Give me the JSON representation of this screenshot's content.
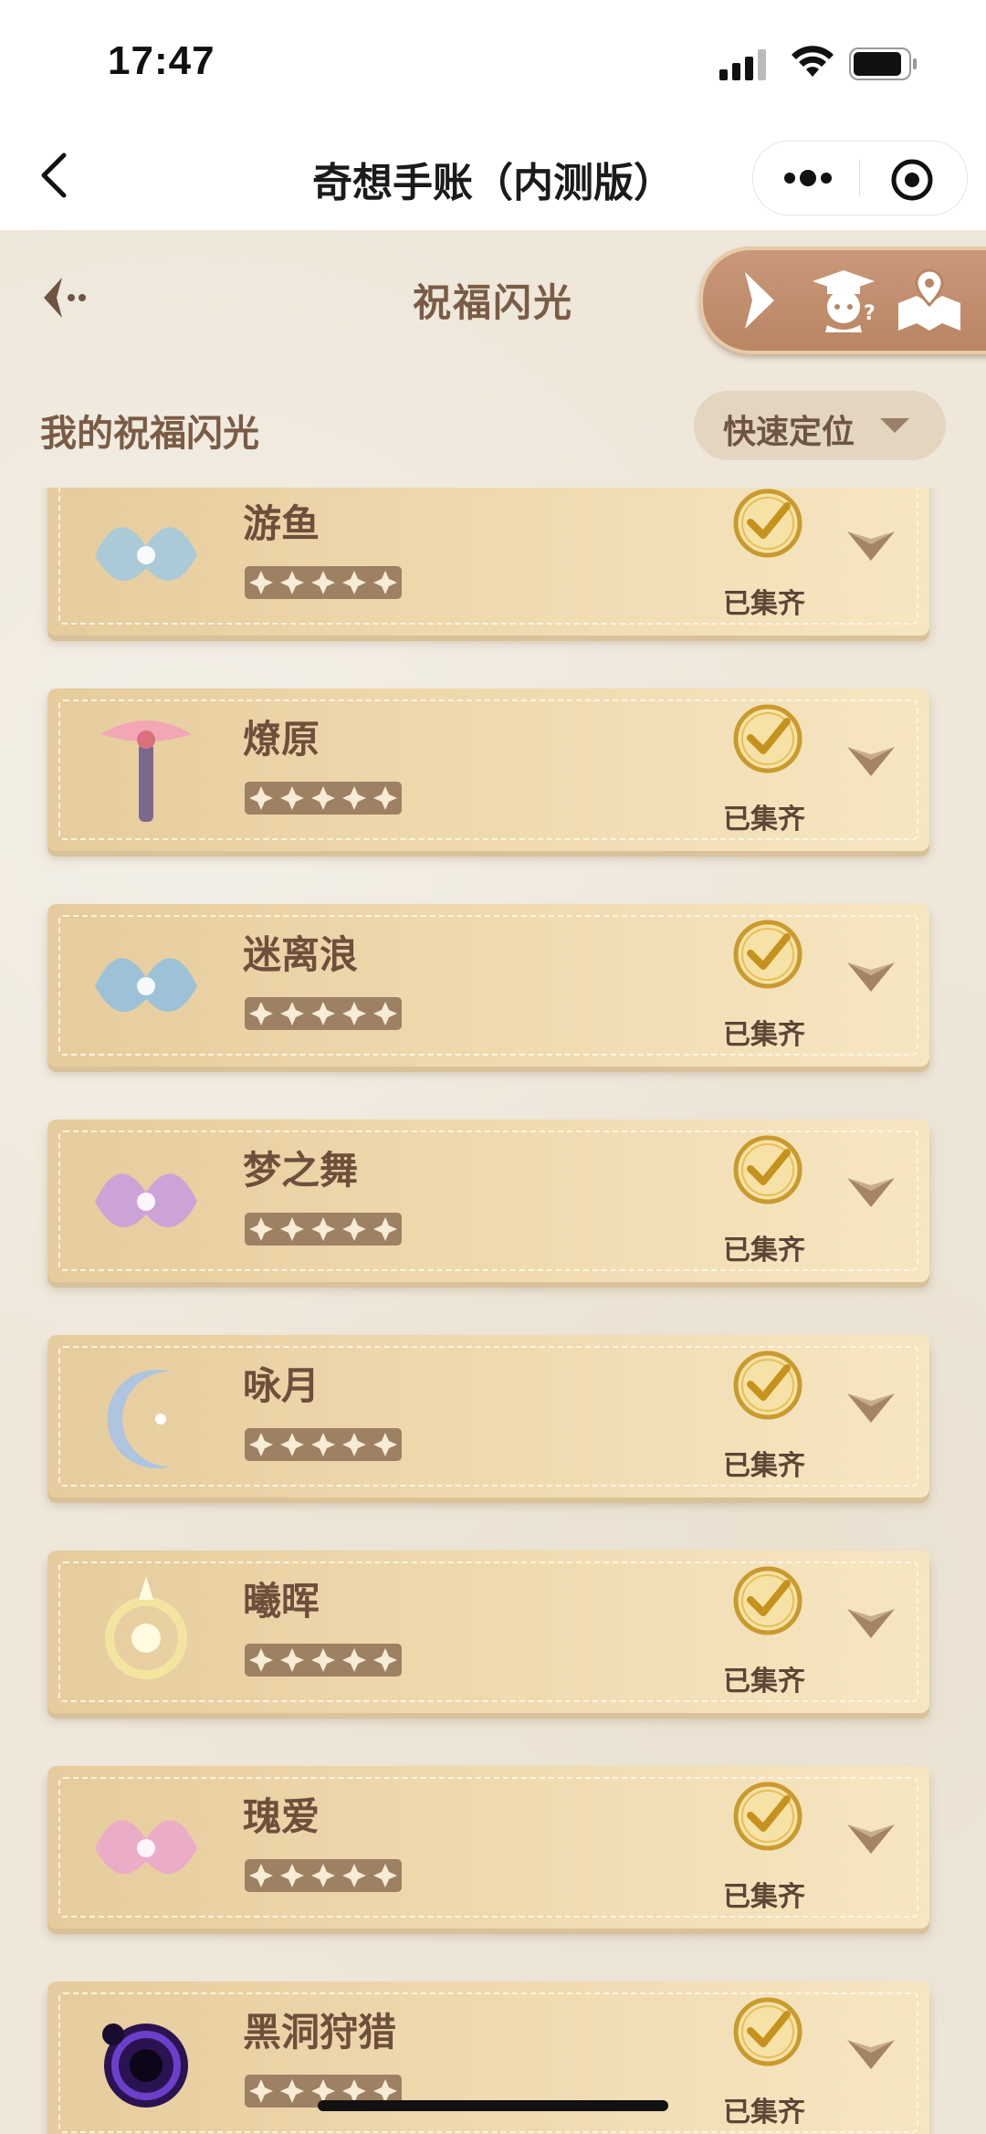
{
  "status_bar": {
    "time": "17:47"
  },
  "navbar": {
    "title": "奇想手账（内测版）"
  },
  "page": {
    "title": "祝福闪光",
    "section_title": "我的祝福闪光",
    "quick_locate_label": "快速定位"
  },
  "items": [
    {
      "name": "游鱼",
      "status": "已集齐",
      "stars": 5,
      "art": "fish-wings-art",
      "accent": "#9fc9e0"
    },
    {
      "name": "燎原",
      "status": "已集齐",
      "stars": 5,
      "art": "red-fairy-art",
      "accent": "#d9707c"
    },
    {
      "name": "迷离浪",
      "status": "已集齐",
      "stars": 5,
      "art": "blue-wave-art",
      "accent": "#8fbfe0"
    },
    {
      "name": "梦之舞",
      "status": "已集齐",
      "stars": 5,
      "art": "purple-wings-art",
      "accent": "#c79be0"
    },
    {
      "name": "咏月",
      "status": "已集齐",
      "stars": 5,
      "art": "crescent-moon-art",
      "accent": "#a7c3e6"
    },
    {
      "name": "曦晖",
      "status": "已集齐",
      "stars": 5,
      "art": "golden-sun-art",
      "accent": "#f3e5a0"
    },
    {
      "name": "瑰爱",
      "status": "已集齐",
      "stars": 5,
      "art": "pink-rose-art",
      "accent": "#eba6cf"
    },
    {
      "name": "黑洞狩猎",
      "status": "已集齐",
      "stars": 5,
      "art": "black-hole-art",
      "accent": "#6b3fc9"
    }
  ]
}
